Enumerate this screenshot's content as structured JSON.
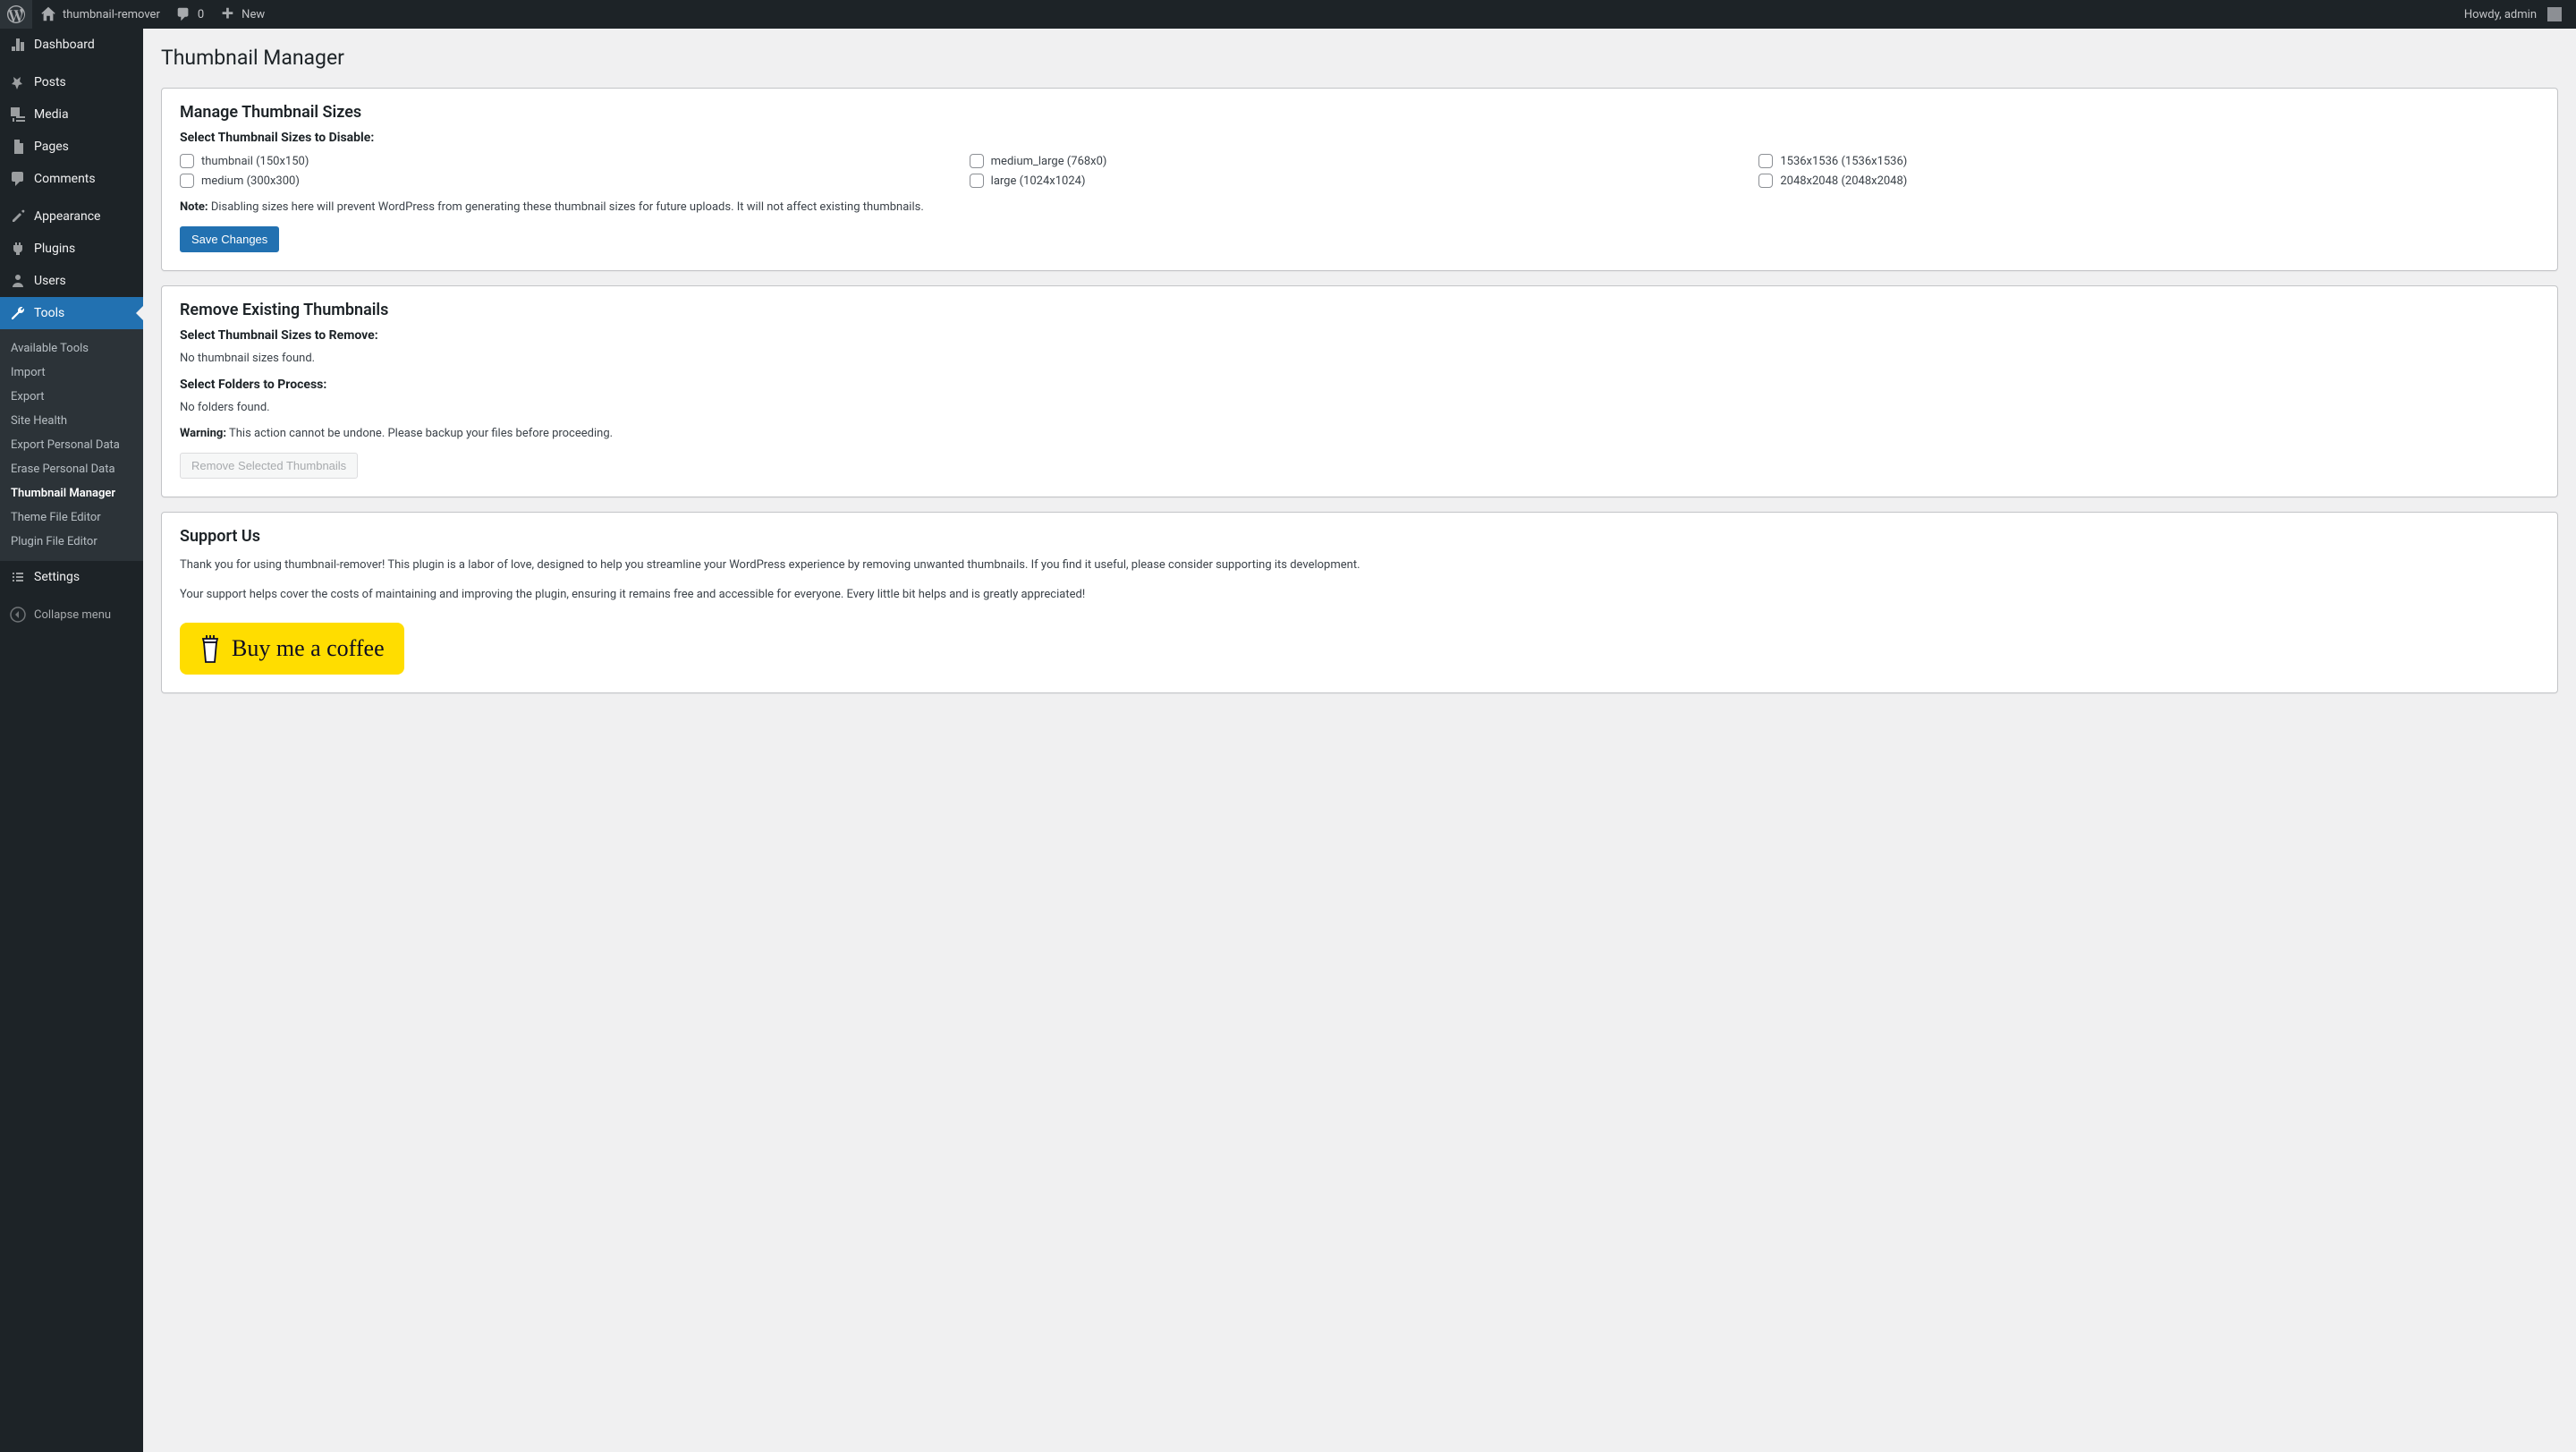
{
  "adminbar": {
    "site_name": "thumbnail-remover",
    "comments_count": "0",
    "new_label": "New",
    "greeting": "Howdy, admin"
  },
  "sidebar": {
    "dashboard": "Dashboard",
    "posts": "Posts",
    "media": "Media",
    "pages": "Pages",
    "comments": "Comments",
    "appearance": "Appearance",
    "plugins": "Plugins",
    "users": "Users",
    "tools": "Tools",
    "settings": "Settings",
    "collapse": "Collapse menu",
    "submenu_tools": {
      "available_tools": "Available Tools",
      "import": "Import",
      "export": "Export",
      "site_health": "Site Health",
      "export_personal": "Export Personal Data",
      "erase_personal": "Erase Personal Data",
      "thumbnail_manager": "Thumbnail Manager",
      "theme_file_editor": "Theme File Editor",
      "plugin_file_editor": "Plugin File Editor"
    }
  },
  "page": {
    "title": "Thumbnail Manager"
  },
  "manage": {
    "heading": "Manage Thumbnail Sizes",
    "select_label": "Select Thumbnail Sizes to Disable:",
    "sizes": [
      "thumbnail (150x150)",
      "medium_large (768x0)",
      "1536x1536 (1536x1536)",
      "medium (300x300)",
      "large (1024x1024)",
      "2048x2048 (2048x2048)"
    ],
    "note_prefix": "Note:",
    "note_text": "Disabling sizes here will prevent WordPress from generating these thumbnail sizes for future uploads. It will not affect existing thumbnails.",
    "save_button": "Save Changes"
  },
  "remove": {
    "heading": "Remove Existing Thumbnails",
    "select_label": "Select Thumbnail Sizes to Remove:",
    "no_sizes": "No thumbnail sizes found.",
    "folders_label": "Select Folders to Process:",
    "no_folders": "No folders found.",
    "warning_prefix": "Warning:",
    "warning_text": "This action cannot be undone. Please backup your files before proceeding.",
    "remove_button": "Remove Selected Thumbnails"
  },
  "support": {
    "heading": "Support Us",
    "p1": "Thank you for using thumbnail-remover! This plugin is a labor of love, designed to help you streamline your WordPress experience by removing unwanted thumbnails. If you find it useful, please consider supporting its development.",
    "p2": "Your support helps cover the costs of maintaining and improving the plugin, ensuring it remains free and accessible for everyone. Every little bit helps and is greatly appreciated!",
    "coffee_label": "Buy me a coffee"
  }
}
